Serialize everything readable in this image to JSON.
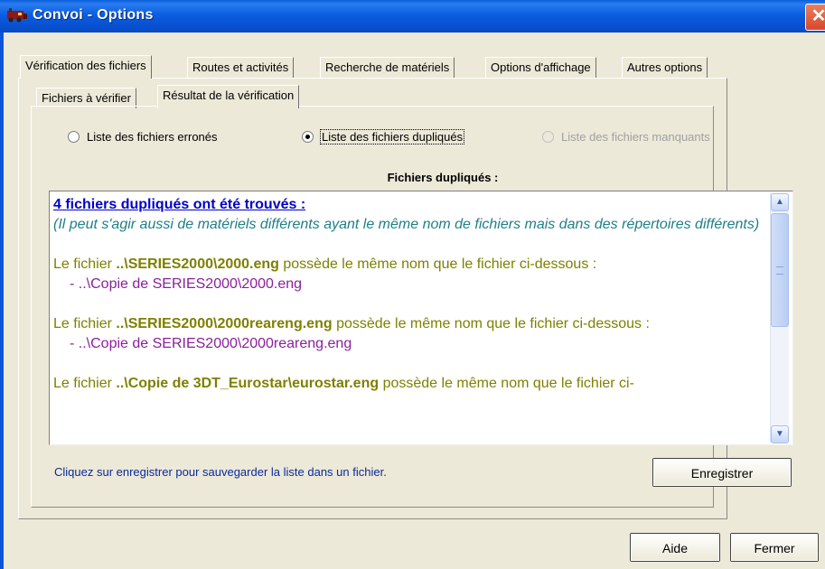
{
  "window": {
    "title": "Convoi - Options",
    "close_label": "✕"
  },
  "tabs": [
    {
      "label": "Vérification des fichiers"
    },
    {
      "label": "Routes et activités"
    },
    {
      "label": "Recherche de matériels"
    },
    {
      "label": "Options d'affichage"
    },
    {
      "label": "Autres options"
    }
  ],
  "subtabs": [
    {
      "label": "Fichiers à vérifier"
    },
    {
      "label": "Résultat de la vérification"
    }
  ],
  "radios": [
    {
      "label": "Liste des fichiers erronés",
      "state": "unchecked"
    },
    {
      "label": "Liste des fichiers dupliqués",
      "state": "checked"
    },
    {
      "label": "Liste des fichiers manquants",
      "state": "disabled"
    }
  ],
  "section_title": "Fichiers dupliqués :",
  "result": {
    "count_line": "4 fichiers dupliqués ont été trouvés :",
    "note": "(Il peut s'agir aussi de matériels différents ayant le même nom de fichiers mais dans des répertoires différents)",
    "entries": [
      {
        "prefix": "Le fichier ",
        "path": "..\\SERIES2000\\2000.eng",
        "suffix": " possède le même nom que le fichier ci-dessous :",
        "duplicate": "- ..\\Copie de SERIES2000\\2000.eng"
      },
      {
        "prefix": "Le fichier ",
        "path": "..\\SERIES2000\\2000reareng.eng",
        "suffix": " possède le même nom que le fichier ci-dessous :",
        "duplicate": "- ..\\Copie de SERIES2000\\2000reareng.eng"
      },
      {
        "prefix": "Le fichier ",
        "path": "..\\Copie de 3DT_Eurostar\\eurostar.eng",
        "suffix": " possède le même nom que le fichier ci-",
        "duplicate": ""
      }
    ]
  },
  "hint": "Cliquez sur enregistrer pour sauvegarder la liste dans un fichier.",
  "buttons": {
    "save": "Enregistrer",
    "help": "Aide",
    "close": "Fermer"
  },
  "colors": {
    "titlebar": "#0a5fd8",
    "count": "#0000cc",
    "note": "#1f7f87",
    "entry": "#7f7f00",
    "duplicate": "#8a1f9a",
    "hint": "#0b2a9a"
  }
}
